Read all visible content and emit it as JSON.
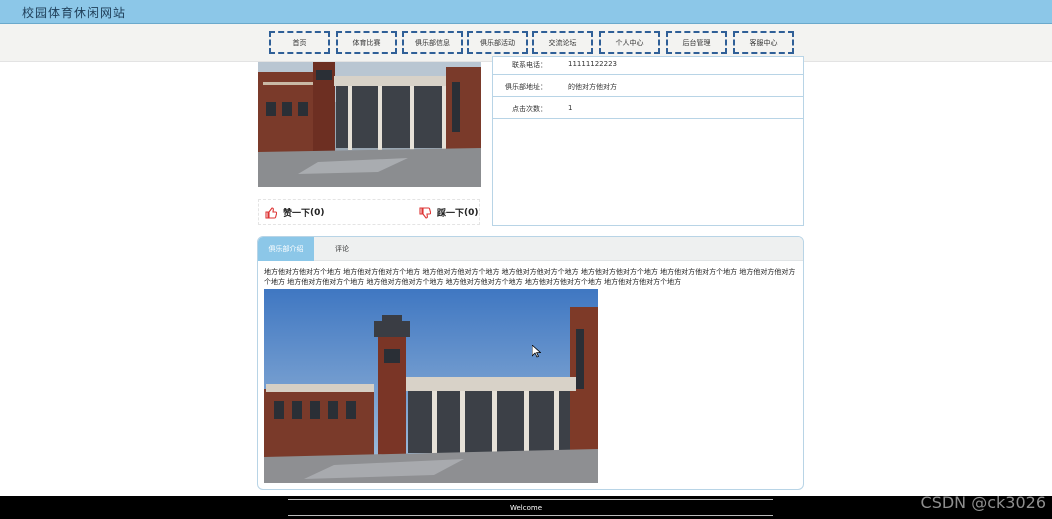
{
  "header": {
    "site_title": "校园体育休闲网站",
    "bg_color": "#8cc7e8"
  },
  "nav": {
    "items": [
      {
        "label": "首页"
      },
      {
        "label": "体育比赛"
      },
      {
        "label": "俱乐部信息"
      },
      {
        "label": "俱乐部活动"
      },
      {
        "label": "交流论坛"
      },
      {
        "label": "个人中心"
      },
      {
        "label": "后台管理"
      },
      {
        "label": "客服中心"
      }
    ]
  },
  "club": {
    "vote_up_label": "赞一下",
    "vote_up_count": "(0)",
    "vote_down_label": "踩一下",
    "vote_down_count": "(0)",
    "info": [
      {
        "label": "联系电话：",
        "value": "11111122223"
      },
      {
        "label": "俱乐部地址：",
        "value": "的他对方他对方"
      },
      {
        "label": "点击次数：",
        "value": "1"
      }
    ]
  },
  "tabs": [
    {
      "label": "俱乐部介绍",
      "active": true
    },
    {
      "label": "评论",
      "active": false
    }
  ],
  "intro": {
    "text": "地方他对方他对方个地方 地方他对方他对方个地方 地方他对方他对方个地方 地方他对方他对方个地方 地方他对方他对方个地方 地方他对方他对方个地方 地方他对方他对方个地方 地方他对方他对方个地方 地方他对方他对方个地方 地方他对方他对方个地方 地方他对方他对方个地方 地方他对方他对方个地方"
  },
  "footer": {
    "text": "Welcome"
  },
  "watermark": {
    "text": "CSDN @ck3026"
  },
  "icons": {
    "vote_up": "thumbs-up-icon",
    "vote_down": "thumbs-down-icon",
    "cursor": "mouse-cursor-icon"
  }
}
